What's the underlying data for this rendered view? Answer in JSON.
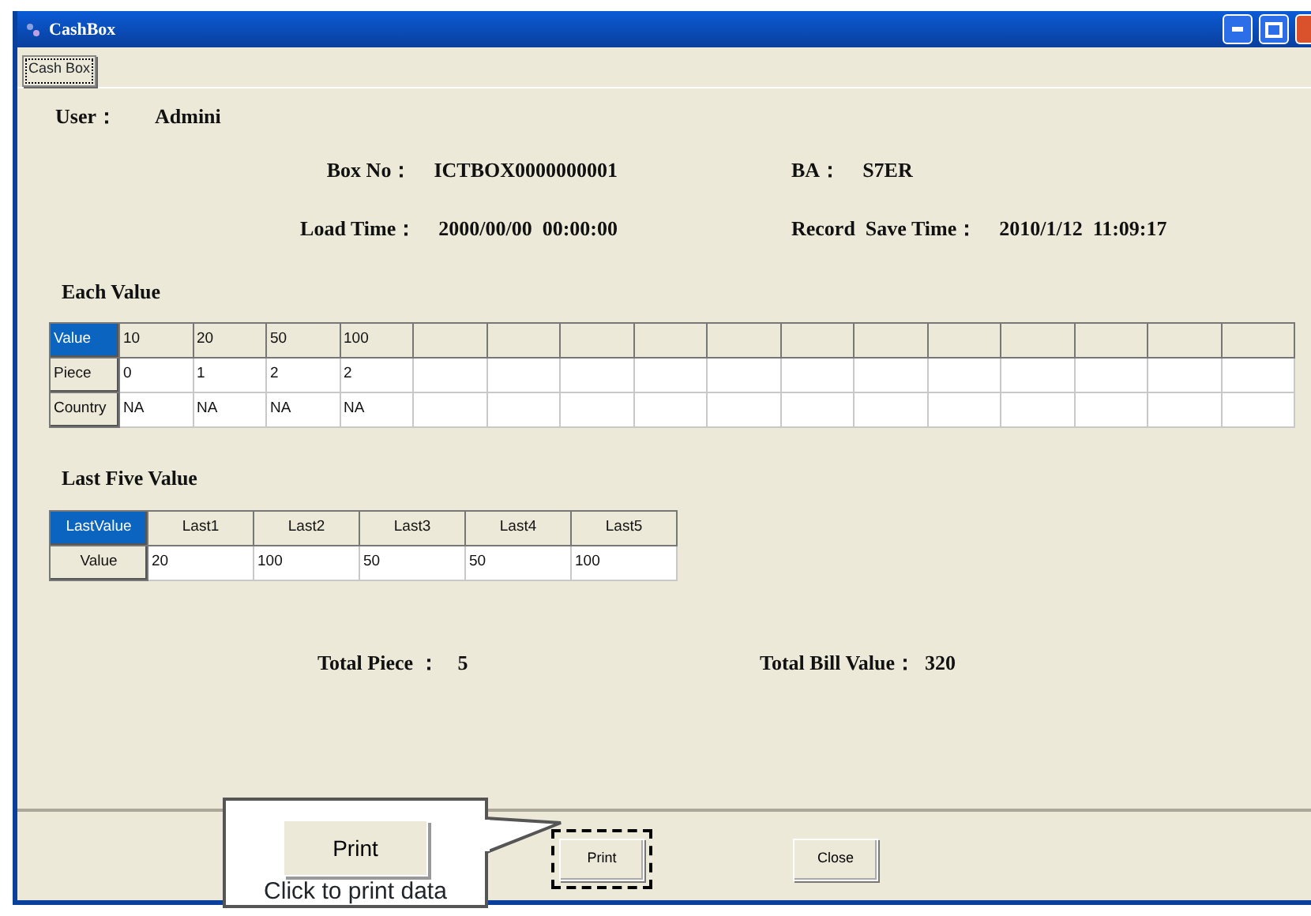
{
  "window": {
    "title": "CashBox"
  },
  "tabs": [
    {
      "label": "Cash Box",
      "selected": true
    }
  ],
  "user": {
    "label": "User：",
    "value": "Admini"
  },
  "info_rows": [
    [
      {
        "label": "Box No：",
        "value": "ICTBOX0000000001"
      },
      {
        "label": "BA：",
        "value": "S7ER"
      }
    ],
    [
      {
        "label": "Load Time：",
        "value": "2000/00/00  00:00:00"
      },
      {
        "label": "Record  Save Time：",
        "value": "2010/1/12  11:09:17"
      }
    ]
  ],
  "each_value": {
    "title": "Each Value",
    "rows": [
      {
        "header": "Value",
        "selected": true,
        "kind": "head",
        "cells": [
          "10",
          "20",
          "50",
          "100"
        ]
      },
      {
        "header": "Piece",
        "selected": false,
        "kind": "body",
        "cells": [
          "0",
          "1",
          "2",
          "2"
        ]
      },
      {
        "header": "Country",
        "selected": false,
        "kind": "body",
        "cells": [
          "NA",
          "NA",
          "NA",
          "NA"
        ]
      }
    ]
  },
  "last_five": {
    "title": "Last Five Value",
    "rows": [
      {
        "header": "LastValue",
        "selected": true,
        "kind": "head",
        "cells": [
          "Last1",
          "Last2",
          "Last3",
          "Last4",
          "Last5"
        ]
      },
      {
        "header": "Value",
        "selected": false,
        "kind": "body",
        "cells": [
          "20",
          "100",
          "50",
          "50",
          "100"
        ]
      }
    ]
  },
  "totals": [
    {
      "label": "Total Piece ：",
      "value": "5"
    },
    {
      "label": "Total Bill Value：",
      "value": "320"
    }
  ],
  "buttons": [
    {
      "label": "Print",
      "highlighted": true
    },
    {
      "label": "Close",
      "highlighted": false
    }
  ],
  "callout": {
    "button_label": "Print",
    "text": "Click to print data"
  }
}
